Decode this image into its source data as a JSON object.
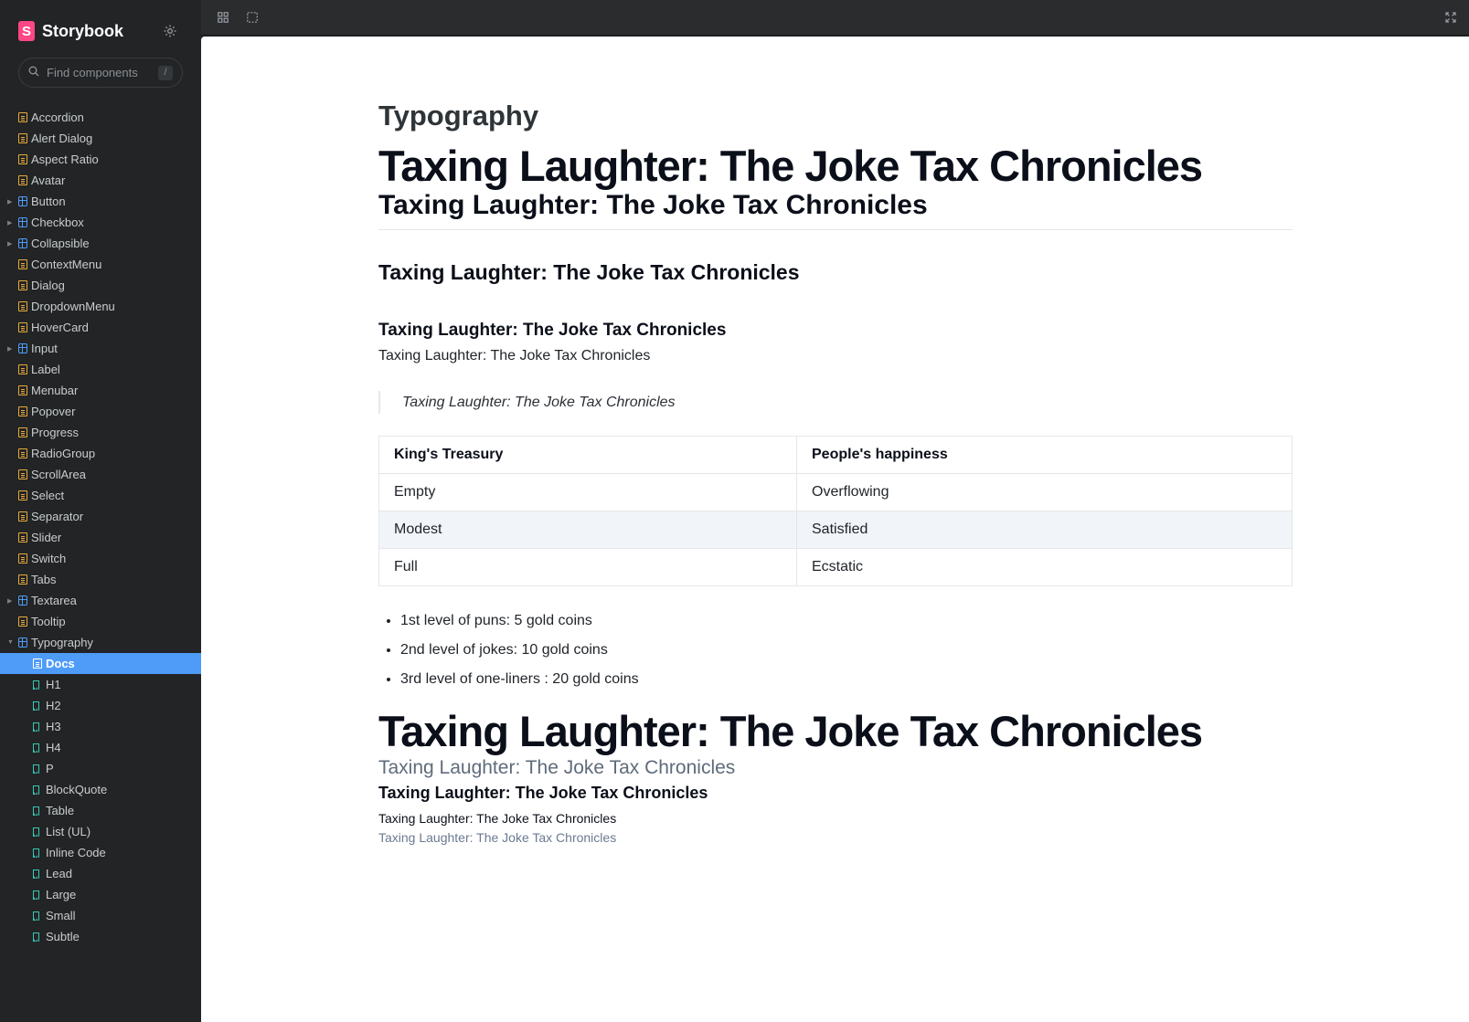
{
  "app": {
    "name": "Storybook",
    "logo_letter": "S"
  },
  "search": {
    "placeholder": "Find components",
    "shortcut": "/"
  },
  "sidebar": {
    "items": [
      {
        "label": "Accordion",
        "type": "doc"
      },
      {
        "label": "Alert Dialog",
        "type": "doc"
      },
      {
        "label": "Aspect Ratio",
        "type": "doc"
      },
      {
        "label": "Avatar",
        "type": "doc"
      },
      {
        "label": "Button",
        "type": "component"
      },
      {
        "label": "Checkbox",
        "type": "component"
      },
      {
        "label": "Collapsible",
        "type": "component"
      },
      {
        "label": "ContextMenu",
        "type": "doc"
      },
      {
        "label": "Dialog",
        "type": "doc"
      },
      {
        "label": "DropdownMenu",
        "type": "doc"
      },
      {
        "label": "HoverCard",
        "type": "doc"
      },
      {
        "label": "Input",
        "type": "component"
      },
      {
        "label": "Label",
        "type": "doc"
      },
      {
        "label": "Menubar",
        "type": "doc"
      },
      {
        "label": "Popover",
        "type": "doc"
      },
      {
        "label": "Progress",
        "type": "doc"
      },
      {
        "label": "RadioGroup",
        "type": "doc"
      },
      {
        "label": "ScrollArea",
        "type": "doc"
      },
      {
        "label": "Select",
        "type": "doc"
      },
      {
        "label": "Separator",
        "type": "doc"
      },
      {
        "label": "Slider",
        "type": "doc"
      },
      {
        "label": "Switch",
        "type": "doc"
      },
      {
        "label": "Tabs",
        "type": "doc"
      },
      {
        "label": "Textarea",
        "type": "component"
      },
      {
        "label": "Tooltip",
        "type": "doc"
      },
      {
        "label": "Typography",
        "type": "component-open"
      },
      {
        "label": "Docs",
        "type": "doc-selected"
      },
      {
        "label": "H1",
        "type": "story"
      },
      {
        "label": "H2",
        "type": "story"
      },
      {
        "label": "H3",
        "type": "story"
      },
      {
        "label": "H4",
        "type": "story"
      },
      {
        "label": "P",
        "type": "story"
      },
      {
        "label": "BlockQuote",
        "type": "story"
      },
      {
        "label": "Table",
        "type": "story"
      },
      {
        "label": "List (UL)",
        "type": "story"
      },
      {
        "label": "Inline Code",
        "type": "story"
      },
      {
        "label": "Lead",
        "type": "story"
      },
      {
        "label": "Large",
        "type": "story"
      },
      {
        "label": "Small",
        "type": "story"
      },
      {
        "label": "Subtle",
        "type": "story"
      }
    ]
  },
  "toolbar": {
    "grid_icon": "grid-icon",
    "outline_icon": "outline-icon",
    "fullscreen_icon": "fullscreen-icon"
  },
  "doc": {
    "title": "Typography",
    "h1": "Taxing Laughter: The Joke Tax Chronicles",
    "h2": "Taxing Laughter: The Joke Tax Chronicles",
    "h3": "Taxing Laughter: The Joke Tax Chronicles",
    "h4": "Taxing Laughter: The Joke Tax Chronicles",
    "p": "Taxing Laughter: The Joke Tax Chronicles",
    "blockquote": "Taxing Laughter: The Joke Tax Chronicles",
    "table": {
      "headers": [
        "King's Treasury",
        "People's happiness"
      ],
      "rows": [
        [
          "Empty",
          "Overflowing"
        ],
        [
          "Modest",
          "Satisfied"
        ],
        [
          "Full",
          "Ecstatic"
        ]
      ]
    },
    "list": [
      "1st level of puns: 5 gold coins",
      "2nd level of jokes: 10 gold coins",
      "3rd level of one-liners : 20 gold coins"
    ],
    "h1_second": "Taxing Laughter: The Joke Tax Chronicles",
    "lead": "Taxing Laughter: The Joke Tax Chronicles",
    "large": "Taxing Laughter: The Joke Tax Chronicles",
    "small": "Taxing Laughter: The Joke Tax Chronicles",
    "subtle": "Taxing Laughter: The Joke Tax Chronicles"
  },
  "colors": {
    "sidebar_bg": "#222425",
    "selected": "#4f9cf8",
    "brand": "#ff4785"
  }
}
